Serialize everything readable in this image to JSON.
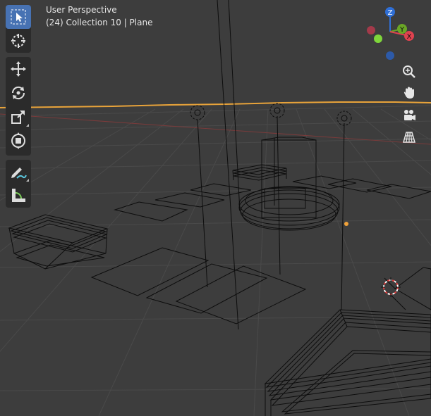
{
  "viewport": {
    "view_name": "User Perspective",
    "object_info": "(24) Collection 10 | Plane"
  },
  "toolbar": {
    "tools": [
      {
        "name": "select-box-tool",
        "icon": "select-box-icon",
        "active": true
      },
      {
        "name": "cursor-tool",
        "icon": "cursor-crosshair-icon",
        "active": false
      },
      {
        "name": "move-tool",
        "icon": "move-arrows-icon",
        "active": false
      },
      {
        "name": "rotate-tool",
        "icon": "rotate-icon",
        "active": false
      },
      {
        "name": "scale-tool",
        "icon": "scale-icon",
        "active": false
      },
      {
        "name": "transform-tool",
        "icon": "transform-icon",
        "active": false
      },
      {
        "name": "annotate-tool",
        "icon": "pencil-icon",
        "active": false
      },
      {
        "name": "measure-tool",
        "icon": "ruler-icon",
        "active": false
      }
    ]
  },
  "gizmo": {
    "z_label": "Z",
    "y_label": "Y",
    "x_label": "X",
    "colors": {
      "z": "#2f6fd6",
      "y": "#6aa626",
      "x": "#e0424f",
      "neg_x": "#a33a4a",
      "neg_y": "#4f7a2a",
      "neg_z": "#2d5aa8"
    }
  },
  "nav_buttons": [
    {
      "name": "zoom-button",
      "icon": "zoom-icon"
    },
    {
      "name": "pan-button",
      "icon": "hand-icon"
    },
    {
      "name": "camera-view-button",
      "icon": "camera-icon"
    },
    {
      "name": "perspective-toggle-button",
      "icon": "grid-icon"
    }
  ],
  "colors": {
    "background": "#3d3d3d",
    "grid": "#474747",
    "horizon": "#e8a33a",
    "wire": "#0d0d0d",
    "active": "#4772b3"
  }
}
